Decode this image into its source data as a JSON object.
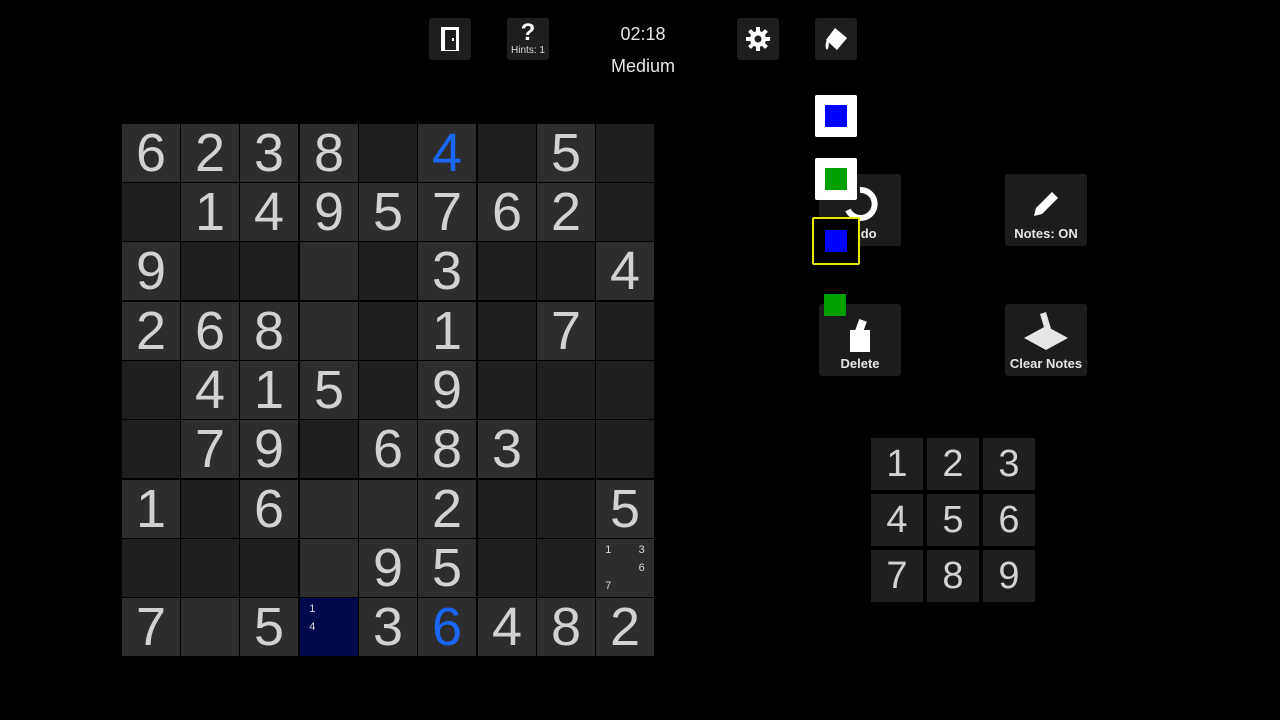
{
  "header": {
    "timer": "02:18",
    "difficulty": "Medium",
    "hints_label": "Hints: 1",
    "hint_symbol": "?"
  },
  "board": {
    "rows": [
      [
        "6",
        "2",
        "3",
        "8",
        "",
        "4",
        "",
        "5",
        ""
      ],
      [
        "",
        "1",
        "4",
        "9",
        "5",
        "7",
        "6",
        "2",
        ""
      ],
      [
        "9",
        "",
        "",
        "",
        "",
        "3",
        "",
        "",
        "4"
      ],
      [
        "2",
        "6",
        "8",
        "",
        "",
        "1",
        "",
        "7",
        ""
      ],
      [
        "",
        "4",
        "1",
        "5",
        "",
        "9",
        "",
        "",
        ""
      ],
      [
        "",
        "7",
        "9",
        "",
        "6",
        "8",
        "3",
        "",
        ""
      ],
      [
        "1",
        "",
        "6",
        "",
        "",
        "2",
        "",
        "",
        "5"
      ],
      [
        "",
        "",
        "",
        "",
        "9",
        "5",
        "",
        "",
        ""
      ],
      [
        "7",
        "",
        "5",
        "",
        "3",
        "6",
        "4",
        "8",
        "2"
      ]
    ],
    "blue_cells": [
      [
        0,
        5
      ],
      [
        8,
        5
      ]
    ],
    "highlighted_cell": [
      8,
      3
    ],
    "notes": [
      {
        "row": 7,
        "col": 8,
        "values": [
          "1",
          "",
          "3",
          "",
          "",
          "6",
          "7",
          "",
          ""
        ]
      },
      {
        "row": 8,
        "col": 3,
        "values": [
          "1",
          "",
          "",
          "4",
          "",
          "",
          "",
          "",
          ""
        ]
      }
    ],
    "colors": {
      "given": "#d2d2d2",
      "user": "#1a66ff",
      "highlight": "#000a4a"
    }
  },
  "actions": {
    "undo_label": "Undo",
    "notes_label": "Notes: ON",
    "delete_label": "Delete",
    "clear_notes_label": "Clear Notes"
  },
  "palette": {
    "colors": [
      "#0000ff",
      "#00a000",
      "#0000ff",
      "#00a000"
    ],
    "selected_index": 2
  },
  "numpad": [
    "1",
    "2",
    "3",
    "4",
    "5",
    "6",
    "7",
    "8",
    "9"
  ]
}
